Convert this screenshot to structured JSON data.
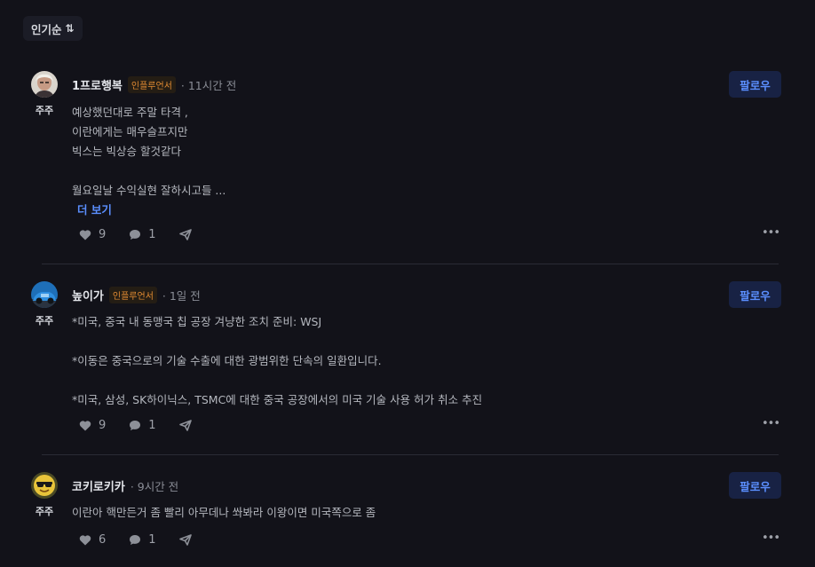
{
  "sort": {
    "label": "인기순",
    "icon": "sort-arrows-icon"
  },
  "posts": [
    {
      "badge": "주주",
      "nickname": "1프로행복",
      "tag": "인플루언서",
      "time": "· 11시간 전",
      "follow_label": "팔로우",
      "lines": [
        "예상했던대로 주말 타격 ,",
        "이란에게는 매우슬프지만",
        "빅스는 빅상승 할것같다",
        "",
        "월요일날 수익실현 잘하시고들 ..."
      ],
      "more_label": "더 보기",
      "likes": "9",
      "comments": "1",
      "avatar": "portrait-photo"
    },
    {
      "badge": "주주",
      "nickname": "높이가",
      "tag": "인플루언서",
      "time": "· 1일 전",
      "follow_label": "팔로우",
      "lines": [
        "*미국, 중국 내 동맹국 칩 공장 겨냥한 조치 준비: WSJ",
        "",
        "*이동은 중국으로의 기술 수출에 대한 광범위한 단속의 일환입니다.",
        "",
        "*미국, 삼성, SK하이닉스, TSMC에 대한 중국 공장에서의 미국 기술 사용 허가 취소 추진"
      ],
      "likes": "9",
      "comments": "1",
      "avatar": "blue-car-photo"
    },
    {
      "badge": "주주",
      "nickname": "코키로키카",
      "time": "· 9시간 전",
      "follow_label": "팔로우",
      "lines": [
        "이란아 핵만든거 좀 빨리 아무데나 쏴봐라 이왕이면 미국쪽으로 좀"
      ],
      "likes": "6",
      "comments": "1",
      "avatar": "sunglasses-emoji"
    }
  ],
  "colors": {
    "background": "#121219",
    "accent": "#5b8fff",
    "tag": "#e08a32"
  }
}
